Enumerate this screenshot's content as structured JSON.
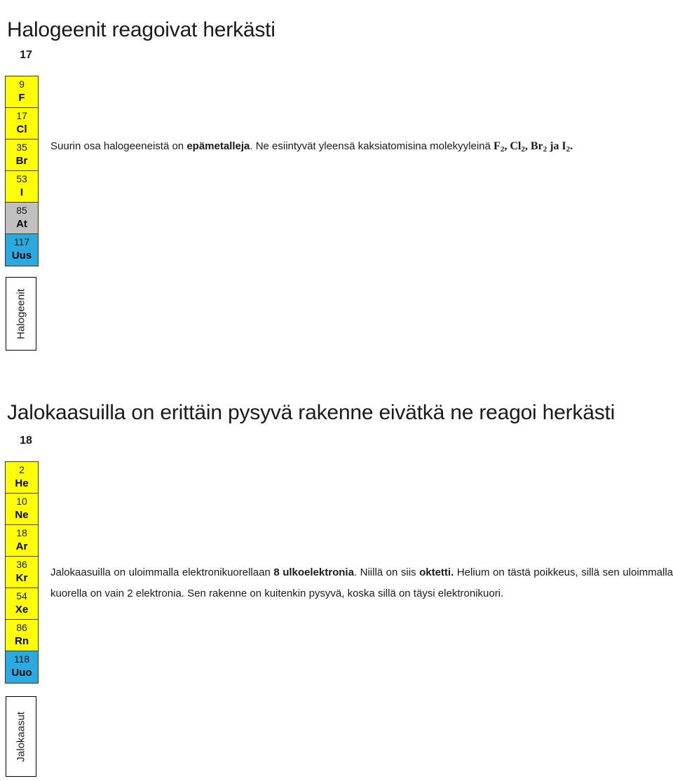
{
  "slides": {
    "halogens": {
      "title": "Halogeenit reagoivat herkästi",
      "group_number": "17",
      "group_label": "Halogeenit",
      "paragraph": {
        "part1": "Suurin osa halogeeneistä on ",
        "bold1": "epämetalleja",
        "part2": ". Ne esiintyvät yleensä kaksiatomisina molekyyleinä ",
        "formulas": [
          {
            "symbol": "F",
            "sub": "2",
            "sep": ", "
          },
          {
            "symbol": "Cl",
            "sub": "2",
            "sep": ", "
          },
          {
            "symbol": "Br",
            "sub": "2",
            "sep": " ja "
          },
          {
            "symbol": "I",
            "sub": "2",
            "sep": "."
          }
        ]
      },
      "elements": [
        {
          "number": "9",
          "symbol": "F",
          "color": "yellow"
        },
        {
          "number": "17",
          "symbol": "Cl",
          "color": "yellow"
        },
        {
          "number": "35",
          "symbol": "Br",
          "color": "yellow"
        },
        {
          "number": "53",
          "symbol": "I",
          "color": "yellow"
        },
        {
          "number": "85",
          "symbol": "At",
          "color": "gray"
        },
        {
          "number": "117",
          "symbol": "Uus",
          "color": "blue"
        }
      ]
    },
    "noblegases": {
      "title": "Jalokaasuilla on erittäin pysyvä rakenne eivätkä ne reagoi herkästi",
      "group_number": "18",
      "group_label": "Jalokaasut",
      "paragraph": {
        "part1": "Jalokaasuilla on uloimmalla elektronikuorellaan ",
        "bold1": "8 ulkoelektronia",
        "part2": ". Niillä on siis ",
        "bold2": "oktetti.",
        "part3": " Helium on tästä poikkeus, sillä sen uloimmalla kuorella on vain 2 elektronia. Sen rakenne on kuitenkin pysyvä, koska sillä on täysi elektronikuori."
      },
      "elements": [
        {
          "number": "2",
          "symbol": "He",
          "color": "yellow"
        },
        {
          "number": "10",
          "symbol": "Ne",
          "color": "yellow"
        },
        {
          "number": "18",
          "symbol": "Ar",
          "color": "yellow"
        },
        {
          "number": "36",
          "symbol": "Kr",
          "color": "yellow"
        },
        {
          "number": "54",
          "symbol": "Xe",
          "color": "yellow"
        },
        {
          "number": "86",
          "symbol": "Rn",
          "color": "yellow"
        },
        {
          "number": "118",
          "symbol": "Uuo",
          "color": "blue"
        }
      ]
    }
  },
  "colors": {
    "yellow": "#ffff00",
    "gray": "#c0c0c0",
    "blue": "#29abe2",
    "text": "#1a1a1a",
    "page_background": "#ffffff"
  }
}
